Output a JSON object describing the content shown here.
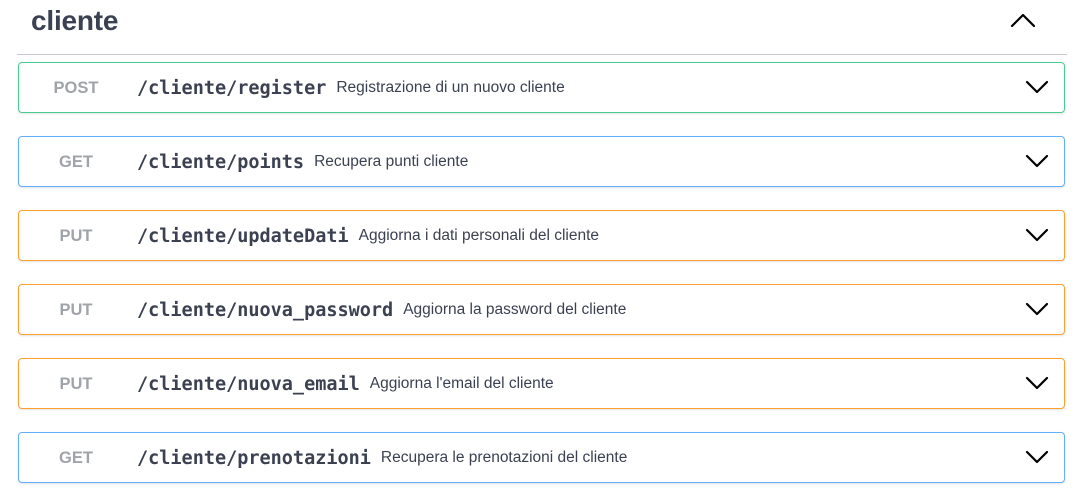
{
  "section": {
    "title": "cliente",
    "collapse_icon": "chevron-up-icon"
  },
  "operations": [
    {
      "method": "POST",
      "path": "/cliente/register",
      "summary": "Registrazione di un nuovo cliente",
      "color": "#49cc90"
    },
    {
      "method": "GET",
      "path": "/cliente/points",
      "summary": "Recupera punti cliente",
      "color": "#61affe"
    },
    {
      "method": "PUT",
      "path": "/cliente/updateDati",
      "summary": "Aggiorna i dati personali del cliente",
      "color": "#fca130"
    },
    {
      "method": "PUT",
      "path": "/cliente/nuova_password",
      "summary": "Aggiorna la password del cliente",
      "color": "#fca130"
    },
    {
      "method": "PUT",
      "path": "/cliente/nuova_email",
      "summary": "Aggiorna l'email del cliente",
      "color": "#fca130"
    },
    {
      "method": "GET",
      "path": "/cliente/prenotazioni",
      "summary": "Recupera le prenotazioni del cliente",
      "color": "#61affe"
    }
  ],
  "icons": {
    "expand": "chevron-down-icon"
  }
}
